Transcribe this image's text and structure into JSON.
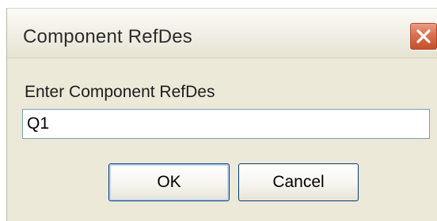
{
  "window": {
    "title": "Component RefDes",
    "close_icon": "close-icon"
  },
  "form": {
    "prompt": "Enter Component RefDes",
    "refdes_value": "Q1"
  },
  "buttons": {
    "ok_label": "OK",
    "cancel_label": "Cancel"
  },
  "colors": {
    "close_button": "#d9714f",
    "dialog_background": "#ece9d8",
    "button_border": "#003c74"
  }
}
